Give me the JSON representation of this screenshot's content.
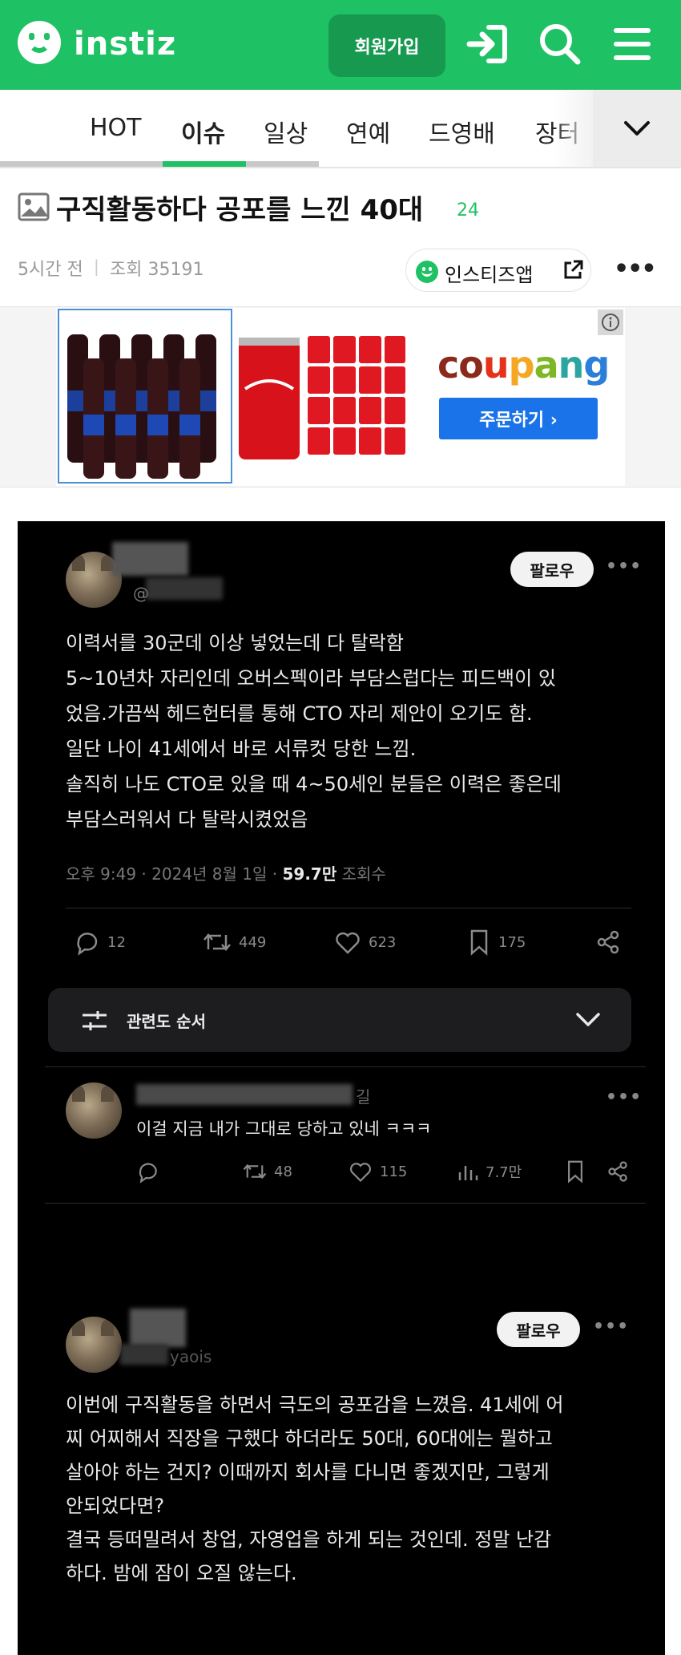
{
  "header": {
    "logo_text": "instiz",
    "signup_label": "회원가입",
    "icons": [
      "smile-logo-icon",
      "login-icon",
      "search-icon",
      "menu-icon"
    ],
    "brand_color": "#1ec164"
  },
  "tabs": {
    "items": [
      "HOT",
      "이슈",
      "일상",
      "연예",
      "드영배",
      "장터"
    ],
    "active": "이슈"
  },
  "post": {
    "title": "구직활동하다 공포를 느낀 40대",
    "comment_count": "24",
    "time": "5시간 전",
    "separator": "|",
    "views": "조회 35191",
    "app_button_label": "인스티즈앱"
  },
  "ad": {
    "brand": "coupang",
    "cta_label": "주문하기 ›"
  },
  "tweet1": {
    "follow_label": "팔로우",
    "handle_prefix": "@",
    "lines": [
      "이력서를 30군데 이상 넣었는데 다 탈락함",
      "5~10년차 자리인데 오버스펙이라 부담스럽다는 피드백이 있",
      "었음.가끔씩 헤드헌터를 통해 CTO 자리 제안이 오기도 함.",
      "일단 나이 41세에서 바로 서류컷 당한 느낌.",
      "솔직히 나도 CTO로 있을 때 4~50세인 분들은 이력은 좋은데",
      "부담스러워서 다 탈락시켰었음"
    ],
    "meta_prefix": "오후 9:49 · 2024년 8월 1일 · ",
    "views_value": "59.7만",
    "views_suffix": " 조회수",
    "replies": "12",
    "retweets": "449",
    "likes": "623",
    "bookmarks": "175"
  },
  "sort_bar": {
    "label": "관련도 순서"
  },
  "reply": {
    "name_suffix": "길",
    "text": "이걸 지금 내가 그대로 당하고 있네 ㅋㅋㅋ",
    "retweets": "48",
    "likes": "115",
    "views": "7.7만"
  },
  "tweet2": {
    "follow_label": "팔로우",
    "handle_partial": "yaois",
    "lines": [
      "이번에 구직활동을 하면서 극도의 공포감을 느꼈음. 41세에 어",
      "찌 어찌해서 직장을 구했다 하더라도 50대, 60대에는 뭘하고",
      "살아야 하는 건지? 이때까지 회사를 다니면 좋겠지만, 그렇게",
      "안되었다면?",
      "결국 등떠밀려서 창업, 자영업을 하게 되는 것인데. 정말 난감",
      "하다. 밤에 잠이 오질 않는다."
    ]
  }
}
